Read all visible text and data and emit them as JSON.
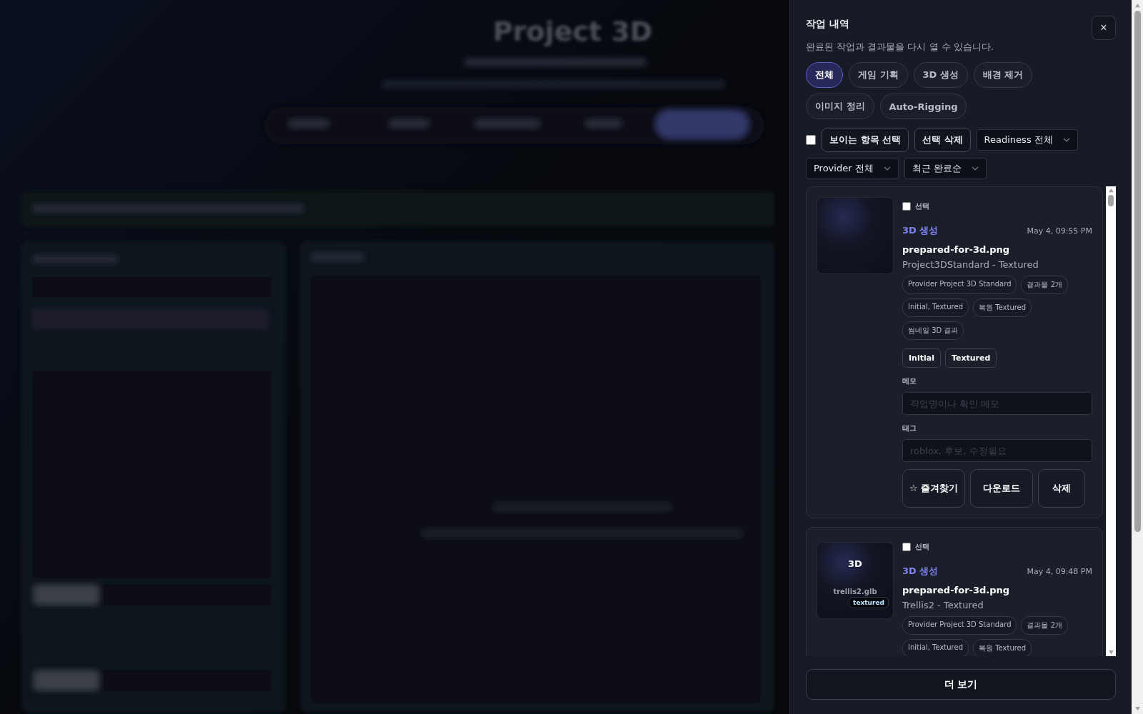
{
  "backdrop": {
    "title": "Project 3D"
  },
  "panel": {
    "title": "작업 내역",
    "subtitle": "완료된 작업과 결과물을 다시 열 수 있습니다.",
    "close": "×"
  },
  "filters": [
    {
      "label": "전체",
      "selected": true
    },
    {
      "label": "게임 기획",
      "selected": false
    },
    {
      "label": "3D 생성",
      "selected": false
    },
    {
      "label": "배경 제거",
      "selected": false
    },
    {
      "label": "이미지 정리",
      "selected": false
    },
    {
      "label": "Auto-Rigging",
      "selected": false
    }
  ],
  "toolbar": {
    "select_all": {
      "checked": false
    },
    "select_visible": "보이는 항목 선택",
    "delete_selected": "선택 삭제",
    "readiness": "Readiness 전체",
    "provider": "Provider 전체",
    "sort": "최근 완료순"
  },
  "jobs": [
    {
      "selected": false,
      "select_label": "선택",
      "category": "3D 생성",
      "time": "May 4, 09:55 PM",
      "file": "prepared-for-3d.png",
      "model": "Project3DStandard - Textured",
      "thumbnail": {
        "kind": "empty"
      },
      "chips": [
        "Provider Project 3D Standard",
        "결과물 2개",
        "Initial, Textured",
        "복원 Textured",
        "썸네일 3D 결과"
      ],
      "variants": [
        "Initial",
        "Textured"
      ],
      "memo_label": "메모",
      "memo_placeholder": "작업명이나 확인 메모",
      "tag_label": "태그",
      "tag_placeholder": "roblox, 후보, 수정필요",
      "actions": [
        "☆ 즐겨찾기",
        "다운로드",
        "삭제"
      ]
    },
    {
      "selected": false,
      "select_label": "선택",
      "category": "3D 생성",
      "time": "May 4, 09:48 PM",
      "file": "prepared-for-3d.png",
      "model": "Trellis2 - Textured",
      "thumbnail": {
        "kind": "model",
        "label": "3D",
        "file": "trellis2.glb",
        "badge": "textured"
      },
      "chips": [
        "Provider Project 3D Standard",
        "결과물 2개",
        "Initial, Textured",
        "복원 Textured"
      ]
    }
  ],
  "more": "더 보기"
}
